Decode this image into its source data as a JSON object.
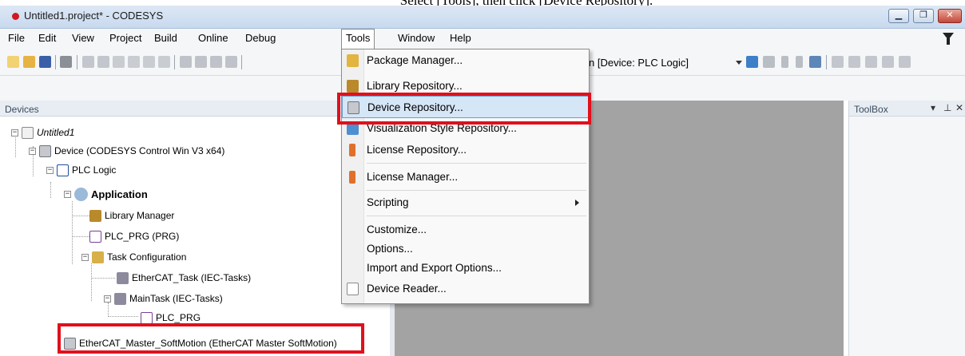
{
  "caption": "Select [Tools], then click [Device Repository].",
  "window": {
    "title": "Untitled1.project* - CODESYS",
    "min_label": "▁",
    "max_label": "❐",
    "close_label": "✕"
  },
  "menubar": {
    "items": [
      "File",
      "Edit",
      "View",
      "Project",
      "Build",
      "Online",
      "Debug",
      "Tools",
      "Window",
      "Help"
    ],
    "open_item": "Tools"
  },
  "toolbar": {
    "device_combo": "n [Device: PLC Logic]"
  },
  "devices_panel": {
    "title": "Devices",
    "tree": [
      {
        "label": "Untitled1",
        "style": "italic"
      },
      {
        "label": "Device (CODESYS Control Win V3 x64)",
        "style": "normal"
      },
      {
        "label": "PLC Logic",
        "style": "normal"
      },
      {
        "label": "Application",
        "style": "bold"
      },
      {
        "label": "Library Manager",
        "style": "normal"
      },
      {
        "label": "PLC_PRG (PRG)",
        "style": "normal"
      },
      {
        "label": "Task Configuration",
        "style": "normal"
      },
      {
        "label": "EtherCAT_Task (IEC-Tasks)",
        "style": "normal"
      },
      {
        "label": "MainTask (IEC-Tasks)",
        "style": "normal"
      },
      {
        "label": "PLC_PRG",
        "style": "normal"
      },
      {
        "label": "EtherCAT_Master_SoftMotion (EtherCAT Master SoftMotion)",
        "style": "normal"
      }
    ]
  },
  "toolbox_panel": {
    "title": "ToolBox",
    "dropdown_glyph": "▾",
    "pin_glyph": "⊥",
    "close_glyph": "✕"
  },
  "tools_menu": {
    "items": [
      {
        "label": "Package Manager...",
        "icon": "package-icon"
      },
      {
        "label": "Library Repository...",
        "icon": "library-icon"
      },
      {
        "label": "Device Repository...",
        "icon": "device-repository-icon",
        "highlighted": true
      },
      {
        "label": "Visualization Style Repository...",
        "icon": "visualization-icon"
      },
      {
        "label": "License Repository...",
        "icon": "license-icon"
      },
      {
        "label": "License Manager...",
        "icon": "license-manager-icon"
      },
      {
        "label": "Scripting",
        "icon": "",
        "submenu": true
      },
      {
        "label": "Customize...",
        "icon": ""
      },
      {
        "label": "Options...",
        "icon": ""
      },
      {
        "label": "Import and Export Options...",
        "icon": ""
      },
      {
        "label": "Device Reader...",
        "icon": "device-reader-icon"
      }
    ]
  },
  "colors": {
    "highlight_box": "#e0101c",
    "menu_hover": "#d5e6f7",
    "editor_bg": "#a3a3a3"
  }
}
